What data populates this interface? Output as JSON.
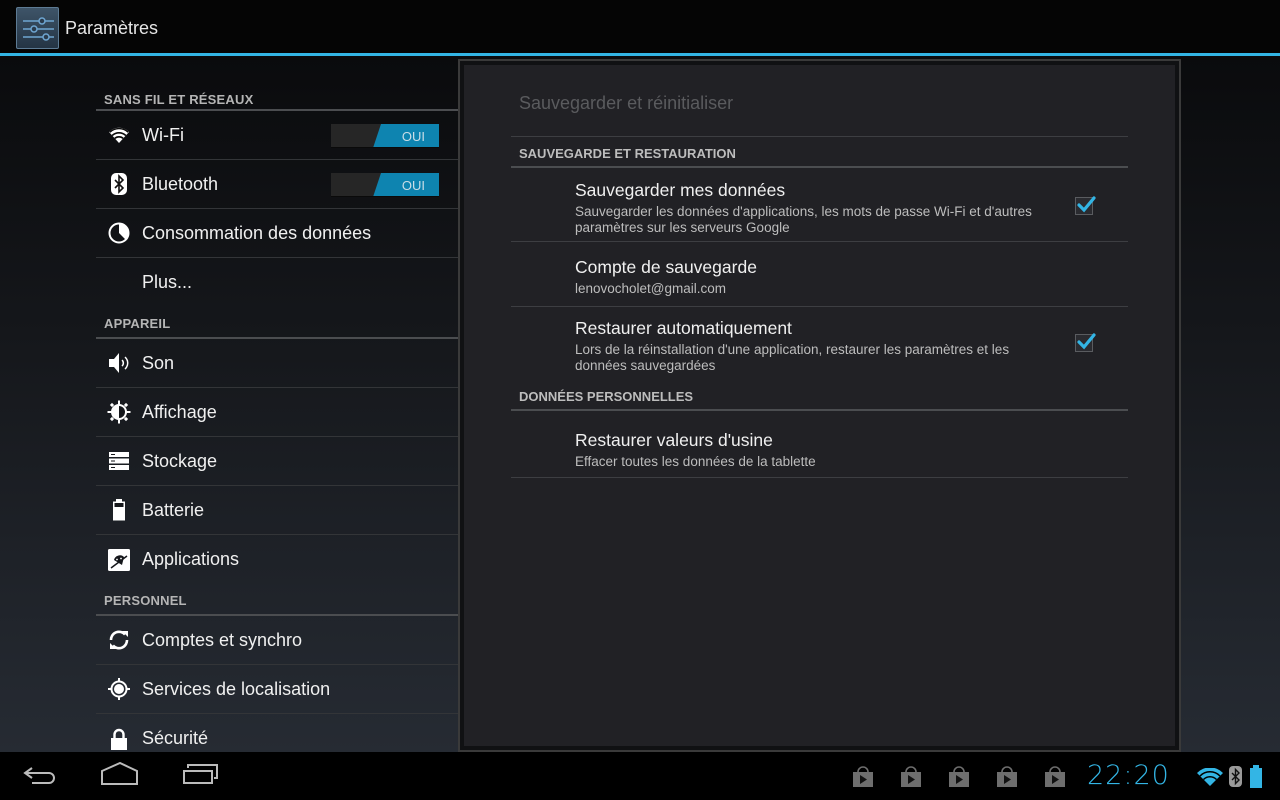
{
  "action_bar": {
    "title": "Paramètres",
    "icon": "settings-sliders-icon",
    "accent_color": "#33b5e5"
  },
  "sidebar": {
    "categories": [
      {
        "header": "SANS FIL ET RÉSEAUX",
        "items": [
          {
            "label": "Wi-Fi",
            "icon": "wifi-icon",
            "toggle": "OUI"
          },
          {
            "label": "Bluetooth",
            "icon": "bluetooth-icon",
            "toggle": "OUI"
          },
          {
            "label": "Consommation des données",
            "icon": "data-usage-icon"
          },
          {
            "label": "Plus...",
            "icon": null
          }
        ]
      },
      {
        "header": "APPAREIL",
        "items": [
          {
            "label": "Son",
            "icon": "sound-icon"
          },
          {
            "label": "Affichage",
            "icon": "display-brightness-icon"
          },
          {
            "label": "Stockage",
            "icon": "storage-icon"
          },
          {
            "label": "Batterie",
            "icon": "battery-icon"
          },
          {
            "label": "Applications",
            "icon": "applications-icon"
          }
        ]
      },
      {
        "header": "PERSONNEL",
        "items": [
          {
            "label": "Comptes et synchro",
            "icon": "sync-icon"
          },
          {
            "label": "Services de localisation",
            "icon": "location-icon"
          },
          {
            "label": "Sécurité",
            "icon": "lock-icon"
          }
        ]
      }
    ]
  },
  "detail": {
    "title": "Sauvegarder et réinitialiser",
    "sections": [
      {
        "header": "SAUVEGARDE ET RESTAURATION",
        "prefs": [
          {
            "title": "Sauvegarder mes données",
            "summary": "Sauvegarder les données d'applications, les mots de passe Wi-Fi et d'autres paramètres sur les serveurs Google",
            "checked": true
          },
          {
            "title": "Compte de sauvegarde",
            "summary": "lenovocholet@gmail.com"
          },
          {
            "title": "Restaurer automatiquement",
            "summary": "Lors de la réinstallation d'une application, restaurer les paramètres et les données sauvegardées",
            "checked": true
          }
        ]
      },
      {
        "header": "DONNÉES PERSONNELLES",
        "prefs": [
          {
            "title": "Restaurer valeurs d'usine",
            "summary": "Effacer toutes les données de la tablette"
          }
        ]
      }
    ]
  },
  "navbar": {
    "buttons": [
      "back",
      "home",
      "recent-apps"
    ],
    "notifications": [
      "play-store-icon",
      "play-store-icon",
      "play-store-icon",
      "play-store-icon",
      "play-store-icon"
    ],
    "clock": "22:20",
    "status_icons": [
      "wifi-signal-icon",
      "bluetooth-icon",
      "battery-icon"
    ]
  }
}
